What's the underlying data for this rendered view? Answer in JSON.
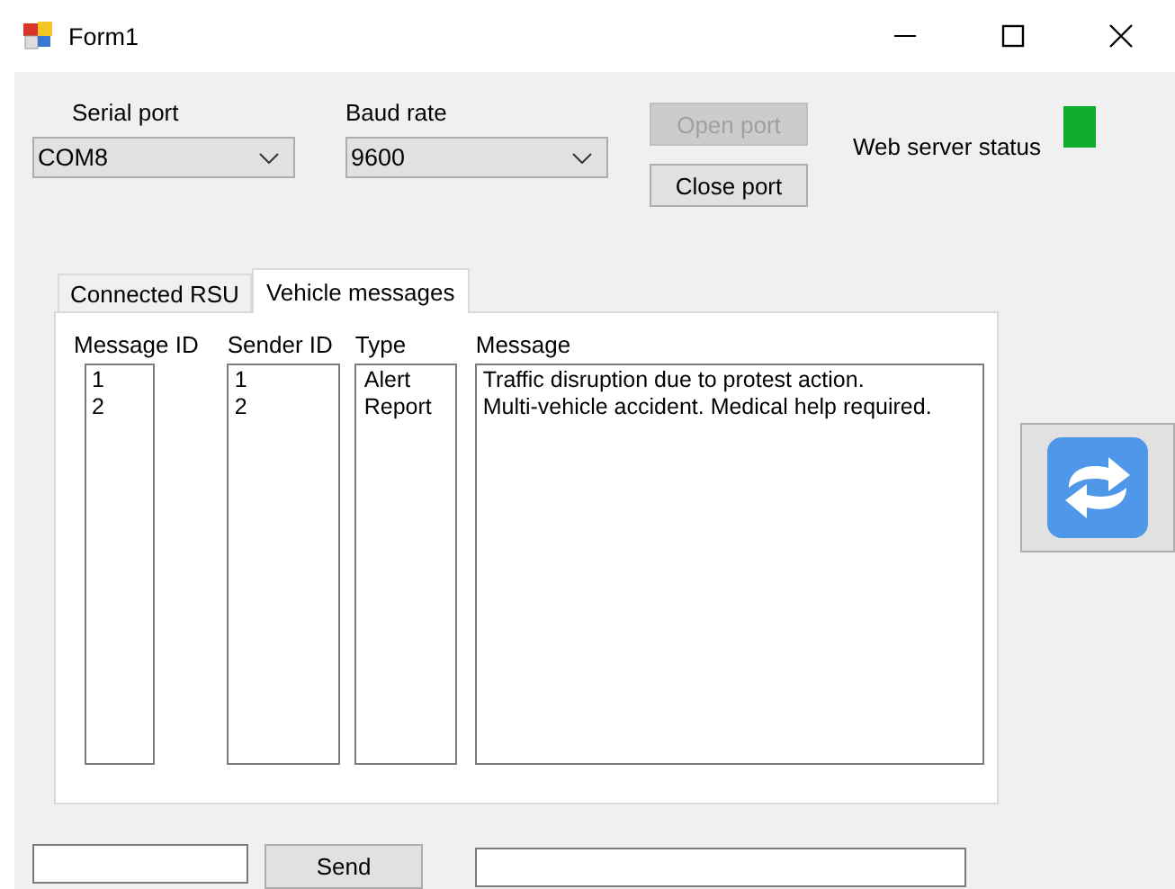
{
  "window": {
    "title": "Form1"
  },
  "serial_port": {
    "label": "Serial port",
    "value": "COM8"
  },
  "baud_rate": {
    "label": "Baud rate",
    "value": "9600"
  },
  "port_buttons": [
    {
      "label": "Open port",
      "disabled": true
    },
    {
      "label": "Close port",
      "disabled": false
    }
  ],
  "web_server_status": {
    "label": "Web server status",
    "on": true
  },
  "tabs": [
    {
      "label": "Connected RSU",
      "selected": false
    },
    {
      "label": "Vehicle messages",
      "selected": true
    }
  ],
  "lists": [
    {
      "header": "Message ID",
      "items": [
        "1",
        "2"
      ]
    },
    {
      "header": "Sender ID",
      "items": [
        "1",
        "2"
      ]
    },
    {
      "header": "Type",
      "items": [
        "Alert",
        "Report"
      ]
    },
    {
      "header": "Message",
      "items": [
        "Traffic disruption due to protest action.",
        "Multi-vehicle accident. Medical help required."
      ]
    }
  ],
  "send_button": {
    "label": "Send"
  }
}
